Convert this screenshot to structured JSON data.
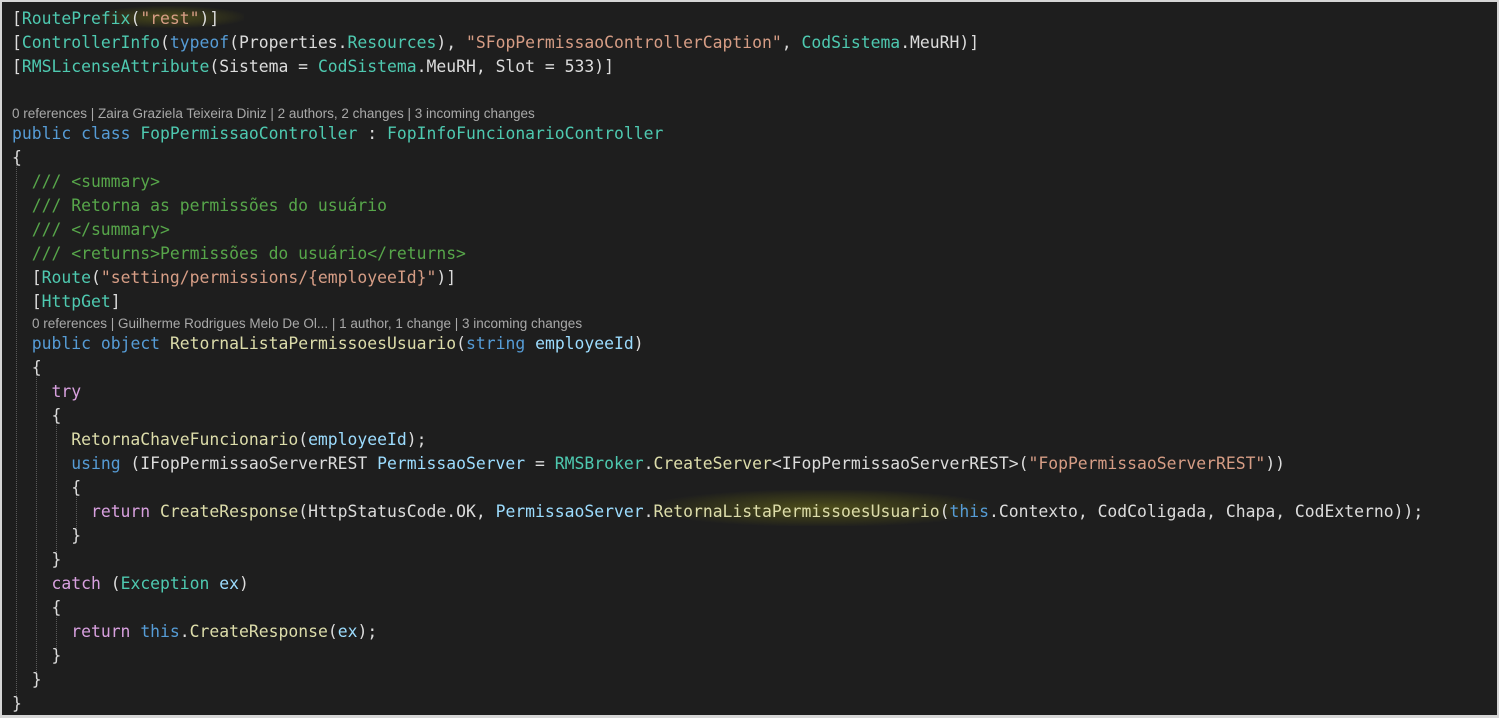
{
  "colors": {
    "background": "#1e1e1e",
    "plain": "#dcdcdc",
    "keyword": "#569cd6",
    "control": "#d8a0df",
    "type": "#4ec9b0",
    "method": "#dcdcaa",
    "string": "#d69d85",
    "comment": "#57a64a",
    "codelens": "#a9a9a9",
    "variable": "#9cdcfe"
  },
  "codelens": [
    {
      "text": "0 references | Zaira Graziela Teixeira Diniz | 2 authors, 2 changes | 3 incoming changes"
    },
    {
      "text": "0 references | Guilherme Rodrigues Melo De Ol... | 1 author, 1 change | 3 incoming changes"
    }
  ],
  "code": [
    [
      {
        "t": "[",
        "c": "plain"
      },
      {
        "t": "RoutePrefix",
        "c": "type"
      },
      {
        "t": "(",
        "c": "plain"
      },
      {
        "t": "\"rest\"",
        "c": "string"
      },
      {
        "t": ")]",
        "c": "plain"
      }
    ],
    [
      {
        "t": "[",
        "c": "plain"
      },
      {
        "t": "ControllerInfo",
        "c": "type"
      },
      {
        "t": "(",
        "c": "plain"
      },
      {
        "t": "typeof",
        "c": "keyword"
      },
      {
        "t": "(Properties.",
        "c": "plain"
      },
      {
        "t": "Resources",
        "c": "type"
      },
      {
        "t": "), ",
        "c": "plain"
      },
      {
        "t": "\"SFopPermissaoControllerCaption\"",
        "c": "string"
      },
      {
        "t": ", ",
        "c": "plain"
      },
      {
        "t": "CodSistema",
        "c": "type"
      },
      {
        "t": ".MeuRH)]",
        "c": "plain"
      }
    ],
    [
      {
        "t": "[",
        "c": "plain"
      },
      {
        "t": "RMSLicenseAttribute",
        "c": "type"
      },
      {
        "t": "(Sistema = ",
        "c": "plain"
      },
      {
        "t": "CodSistema",
        "c": "type"
      },
      {
        "t": ".MeuRH, Slot = 533)]",
        "c": "plain"
      }
    ],
    [],
    [
      {
        "t": "public",
        "c": "keyword"
      },
      {
        "t": " ",
        "c": "plain"
      },
      {
        "t": "class",
        "c": "keyword"
      },
      {
        "t": " ",
        "c": "plain"
      },
      {
        "t": "FopPermissaoController",
        "c": "type"
      },
      {
        "t": " : ",
        "c": "plain"
      },
      {
        "t": "FopInfoFuncionarioController",
        "c": "type"
      }
    ],
    [
      {
        "t": "{",
        "c": "plain"
      }
    ],
    [
      {
        "t": "  /// <summary>",
        "c": "comment"
      }
    ],
    [
      {
        "t": "  /// Retorna as permissões do usuário",
        "c": "comment"
      }
    ],
    [
      {
        "t": "  /// </summary>",
        "c": "comment"
      }
    ],
    [
      {
        "t": "  /// <returns>Permissões do usuário</returns>",
        "c": "comment"
      }
    ],
    [
      {
        "t": "  [",
        "c": "plain"
      },
      {
        "t": "Route",
        "c": "type"
      },
      {
        "t": "(",
        "c": "plain"
      },
      {
        "t": "\"setting/permissions/{employeeId}\"",
        "c": "string"
      },
      {
        "t": ")]",
        "c": "plain"
      }
    ],
    [
      {
        "t": "  [",
        "c": "plain"
      },
      {
        "t": "HttpGet",
        "c": "type"
      },
      {
        "t": "]",
        "c": "plain"
      }
    ],
    [
      {
        "t": "  ",
        "c": "plain"
      },
      {
        "t": "public",
        "c": "keyword"
      },
      {
        "t": " ",
        "c": "plain"
      },
      {
        "t": "object",
        "c": "keyword"
      },
      {
        "t": " ",
        "c": "plain"
      },
      {
        "t": "RetornaListaPermissoesUsuario",
        "c": "method"
      },
      {
        "t": "(",
        "c": "plain"
      },
      {
        "t": "string",
        "c": "keyword"
      },
      {
        "t": " ",
        "c": "plain"
      },
      {
        "t": "employeeId",
        "c": "variable"
      },
      {
        "t": ")",
        "c": "plain"
      }
    ],
    [
      {
        "t": "  {",
        "c": "plain"
      }
    ],
    [
      {
        "t": "    ",
        "c": "plain"
      },
      {
        "t": "try",
        "c": "control"
      }
    ],
    [
      {
        "t": "    {",
        "c": "plain"
      }
    ],
    [
      {
        "t": "      ",
        "c": "plain"
      },
      {
        "t": "RetornaChaveFuncionario",
        "c": "method"
      },
      {
        "t": "(",
        "c": "plain"
      },
      {
        "t": "employeeId",
        "c": "variable"
      },
      {
        "t": ");",
        "c": "plain"
      }
    ],
    [
      {
        "t": "      ",
        "c": "plain"
      },
      {
        "t": "using",
        "c": "keyword"
      },
      {
        "t": " (IFopPermissaoServerREST ",
        "c": "plain"
      },
      {
        "t": "PermissaoServer",
        "c": "variable"
      },
      {
        "t": " = ",
        "c": "plain"
      },
      {
        "t": "RMSBroker",
        "c": "type"
      },
      {
        "t": ".",
        "c": "plain"
      },
      {
        "t": "CreateServer",
        "c": "method"
      },
      {
        "t": "<IFopPermissaoServerREST>(",
        "c": "plain"
      },
      {
        "t": "\"FopPermissaoServerREST\"",
        "c": "string"
      },
      {
        "t": "))",
        "c": "plain"
      }
    ],
    [
      {
        "t": "      {",
        "c": "plain"
      }
    ],
    [
      {
        "t": "        ",
        "c": "plain"
      },
      {
        "t": "return",
        "c": "control"
      },
      {
        "t": " ",
        "c": "plain"
      },
      {
        "t": "CreateResponse",
        "c": "method"
      },
      {
        "t": "(HttpStatusCode.OK, ",
        "c": "plain"
      },
      {
        "t": "PermissaoServer",
        "c": "variable"
      },
      {
        "t": ".",
        "c": "plain"
      },
      {
        "t": "RetornaListaPermissoesUsuario",
        "c": "method"
      },
      {
        "t": "(",
        "c": "plain"
      },
      {
        "t": "this",
        "c": "keyword"
      },
      {
        "t": ".Contexto, CodColigada, Chapa, CodExterno));",
        "c": "plain"
      }
    ],
    [
      {
        "t": "      }",
        "c": "plain"
      }
    ],
    [
      {
        "t": "    }",
        "c": "plain"
      }
    ],
    [
      {
        "t": "    ",
        "c": "plain"
      },
      {
        "t": "catch",
        "c": "control"
      },
      {
        "t": " (",
        "c": "plain"
      },
      {
        "t": "Exception",
        "c": "type"
      },
      {
        "t": " ",
        "c": "plain"
      },
      {
        "t": "ex",
        "c": "variable"
      },
      {
        "t": ")",
        "c": "plain"
      }
    ],
    [
      {
        "t": "    {",
        "c": "plain"
      }
    ],
    [
      {
        "t": "      ",
        "c": "plain"
      },
      {
        "t": "return",
        "c": "control"
      },
      {
        "t": " ",
        "c": "plain"
      },
      {
        "t": "this",
        "c": "keyword"
      },
      {
        "t": ".",
        "c": "plain"
      },
      {
        "t": "CreateResponse",
        "c": "method"
      },
      {
        "t": "(",
        "c": "plain"
      },
      {
        "t": "ex",
        "c": "variable"
      },
      {
        "t": ");",
        "c": "plain"
      }
    ],
    [
      {
        "t": "    }",
        "c": "plain"
      }
    ],
    [
      {
        "t": "  }",
        "c": "plain"
      }
    ],
    [
      {
        "t": "}",
        "c": "plain"
      }
    ]
  ]
}
